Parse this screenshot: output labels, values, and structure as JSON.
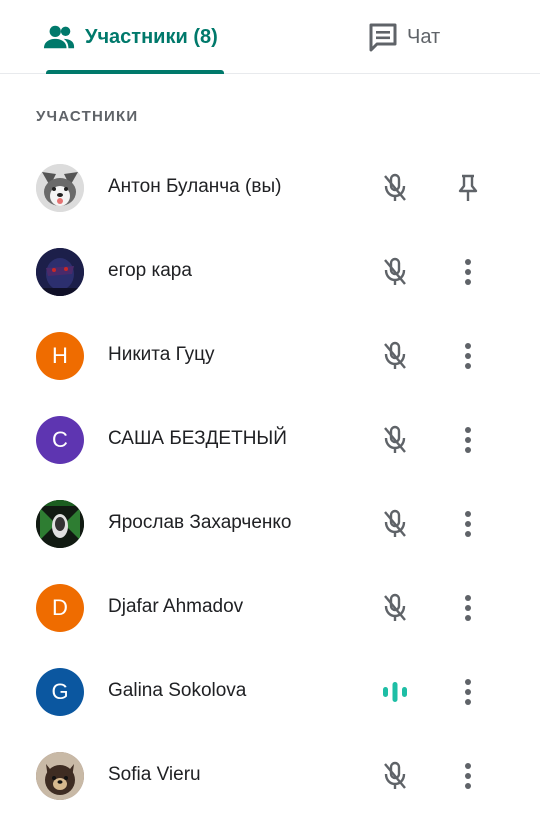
{
  "tabs": {
    "people_label": "Участники (8)",
    "chat_label": "Чат"
  },
  "section_title": "УЧАСТНИКИ",
  "colors": {
    "accent": "#00796b",
    "speaking": "#1ebea5",
    "icon_gray": "#5f6368"
  },
  "participants": [
    {
      "name": "Антон Буланча (вы)",
      "avatar_type": "photo",
      "mic": "muted",
      "action": "pin-icon"
    },
    {
      "name": "егор кара",
      "avatar_type": "photo",
      "mic": "muted",
      "action": "more-vert-icon"
    },
    {
      "name": "Никита Гуцу",
      "avatar_letter": "Н",
      "avatar_color": "#ef6c00",
      "mic": "muted",
      "action": "more-vert-icon"
    },
    {
      "name": "САША БЕЗДЕТНЫЙ",
      "avatar_letter": "С",
      "avatar_color": "#5e35b1",
      "mic": "muted",
      "action": "more-vert-icon"
    },
    {
      "name": "Ярослав Захарченко",
      "avatar_type": "photo",
      "mic": "muted",
      "action": "more-vert-icon"
    },
    {
      "name": "Djafar Ahmadov",
      "avatar_letter": "D",
      "avatar_color": "#ef6c00",
      "mic": "muted",
      "action": "more-vert-icon"
    },
    {
      "name": "Galina Sokolova",
      "avatar_letter": "G",
      "avatar_color": "#0b57a0",
      "mic": "speaking",
      "action": "more-vert-icon"
    },
    {
      "name": "Sofia Vieru",
      "avatar_type": "photo",
      "mic": "muted",
      "action": "more-vert-icon"
    }
  ]
}
